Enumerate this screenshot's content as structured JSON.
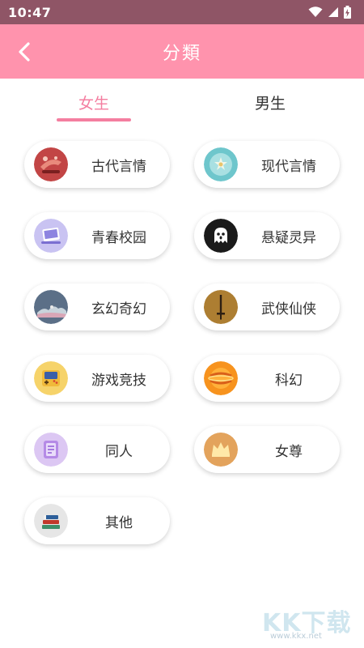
{
  "status_bar": {
    "time": "10:47",
    "icons": [
      "wifi-icon",
      "signal-icon",
      "battery-charging-icon"
    ]
  },
  "app_bar": {
    "title": "分類",
    "back_icon": "back-arrow-icon",
    "color": "#ff93ad"
  },
  "tabs": [
    {
      "label": "女生",
      "selected": true
    },
    {
      "label": "男生",
      "selected": false
    }
  ],
  "accent_color": "#f47ea0",
  "categories": [
    {
      "label": "古代言情",
      "icon": "ancient-romance-icon"
    },
    {
      "label": "现代言情",
      "icon": "modern-romance-icon"
    },
    {
      "label": "青春校园",
      "icon": "campus-icon"
    },
    {
      "label": "悬疑灵异",
      "icon": "ghost-icon"
    },
    {
      "label": "玄幻奇幻",
      "icon": "fantasy-icon"
    },
    {
      "label": "武侠仙侠",
      "icon": "sword-icon"
    },
    {
      "label": "游戏竞技",
      "icon": "game-console-icon"
    },
    {
      "label": "科幻",
      "icon": "planet-icon"
    },
    {
      "label": "同人",
      "icon": "fanfic-icon"
    },
    {
      "label": "女尊",
      "icon": "crown-icon"
    },
    {
      "label": "其他",
      "icon": "books-icon"
    }
  ],
  "watermark": {
    "text": "KK下载",
    "url": "www.kkx.net"
  }
}
